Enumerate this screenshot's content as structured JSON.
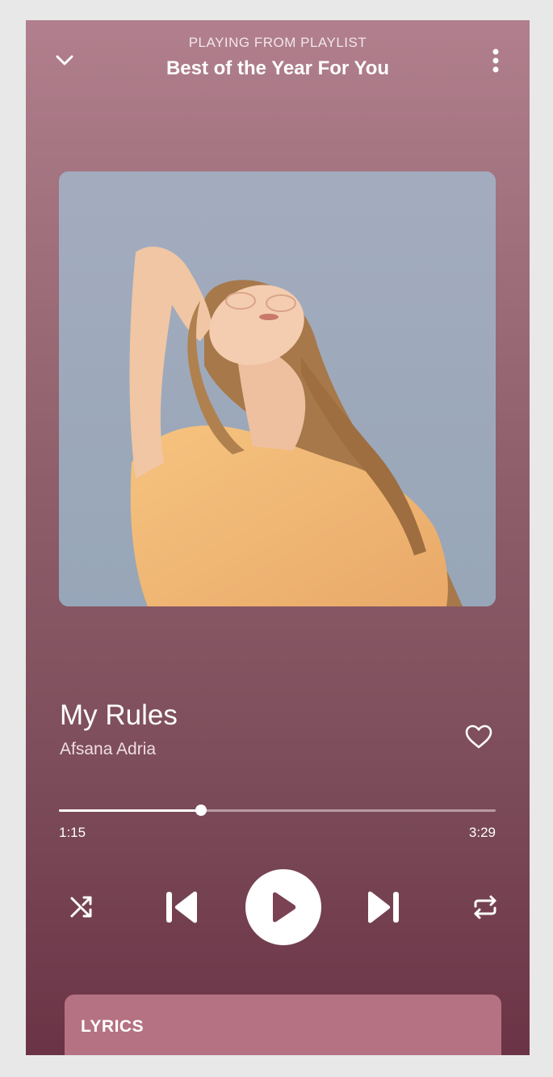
{
  "header": {
    "context_label": "PLAYING FROM PLAYLIST",
    "playlist_title": "Best of the Year For You",
    "collapse_icon": "chevron-down-icon",
    "menu_icon": "more-vertical-icon"
  },
  "track": {
    "title": "My Rules",
    "artist": "Afsana Adria",
    "liked": false
  },
  "playback": {
    "elapsed": "1:15",
    "duration": "3:29",
    "progress": 0.325,
    "is_playing": false
  },
  "controls": {
    "shuffle_icon": "shuffle-icon",
    "previous_icon": "skip-previous-icon",
    "play_icon": "play-icon",
    "next_icon": "skip-next-icon",
    "repeat_icon": "repeat-icon"
  },
  "lyrics": {
    "label": "LYRICS"
  },
  "colors": {
    "background_top": "#b17f8d",
    "background_bottom": "#6b3446",
    "lyrics_card": "#b57283",
    "accent": "#ffffff"
  }
}
